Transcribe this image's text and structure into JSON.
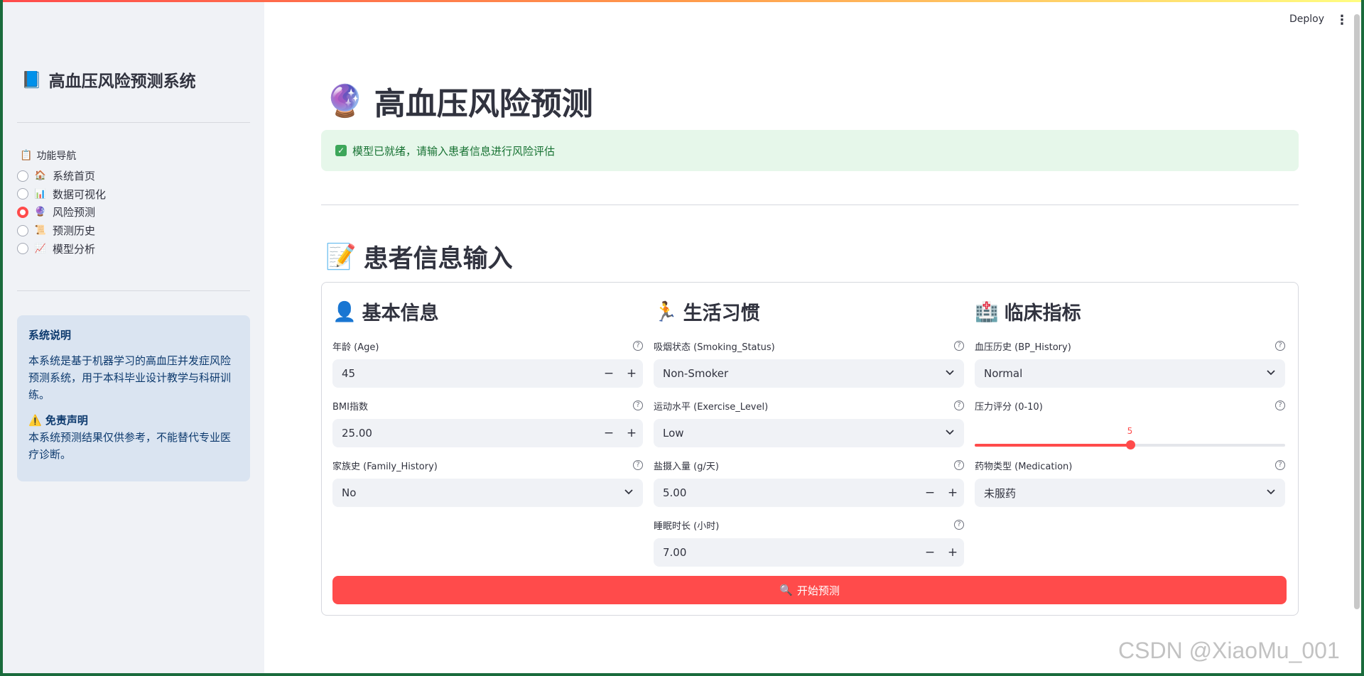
{
  "header": {
    "deploy_label": "Deploy",
    "menu_icon": "more-vertical-icon"
  },
  "sidebar": {
    "title": "高血压风险预测系统",
    "title_icon": "📘",
    "nav_title": "功能导航",
    "nav_title_icon": "📋",
    "items": [
      {
        "icon": "🏠",
        "label": "系统首页",
        "selected": false
      },
      {
        "icon": "📊",
        "label": "数据可视化",
        "selected": false
      },
      {
        "icon": "🔮",
        "label": "风险预测",
        "selected": true
      },
      {
        "icon": "📜",
        "label": "预测历史",
        "selected": false
      },
      {
        "icon": "📈",
        "label": "模型分析",
        "selected": false
      }
    ],
    "info": {
      "heading": "系统说明",
      "body": "本系统是基于机器学习的高血压并发症风险预测系统，用于本科毕业设计教学与科研训练。",
      "disclaimer_icon": "⚠️",
      "disclaimer_title": "免责声明",
      "disclaimer_body": "本系统预测结果仅供参考，不能替代专业医疗诊断。"
    }
  },
  "main": {
    "title": "高血压风险预测",
    "title_icon": "🔮",
    "alert": "模型已就绪，请输入患者信息进行风险评估",
    "section_title": "患者信息输入",
    "section_icon": "📝",
    "columns": {
      "basic": {
        "title": "基本信息",
        "icon": "👤",
        "age_label": "年龄 (Age)",
        "age_value": "45",
        "bmi_label": "BMI指数",
        "bmi_value": "25.00",
        "family_label": "家族史 (Family_History)",
        "family_value": "No"
      },
      "lifestyle": {
        "title": "生活习惯",
        "icon": "🏃",
        "smoking_label": "吸烟状态 (Smoking_Status)",
        "smoking_value": "Non-Smoker",
        "exercise_label": "运动水平 (Exercise_Level)",
        "exercise_value": "Low",
        "salt_label": "盐摄入量 (g/天)",
        "salt_value": "5.00",
        "sleep_label": "睡眠时长 (小时)",
        "sleep_value": "7.00"
      },
      "clinical": {
        "title": "临床指标",
        "icon": "🏥",
        "bp_label": "血压历史 (BP_History)",
        "bp_value": "Normal",
        "stress_label": "压力评分 (0-10)",
        "stress_value": "5",
        "stress_min": 0,
        "stress_max": 10,
        "med_label": "药物类型 (Medication)",
        "med_value": "未服药"
      }
    },
    "predict_button": "开始预测",
    "predict_icon": "🔍"
  },
  "watermark": "CSDN @XiaoMu_001",
  "colors": {
    "accent": "#ff4b4b",
    "sidebar_bg": "#f0f2f6",
    "info_bg": "#dae4f1",
    "success_bg": "#e6f7ea"
  }
}
